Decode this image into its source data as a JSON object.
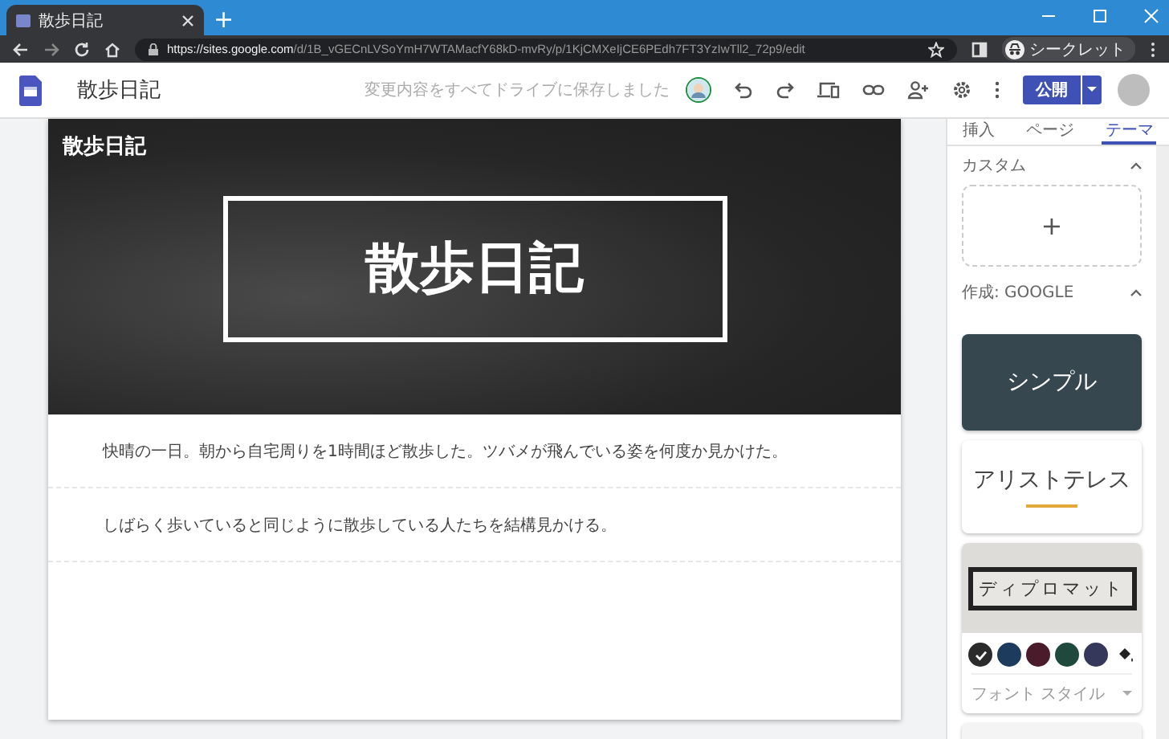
{
  "browser": {
    "tab_title": "散歩日記",
    "new_tab": "+",
    "url_host": "https://sites.google.com",
    "url_path": "/d/1B_vGECnLVSoYmH7WTAMacfY68kD-mvRy/p/1KjCMXeIjCE6PEdh7FT3YzIwTll2_72p9/edit",
    "profile": "シークレット"
  },
  "toolbar": {
    "site_title": "散歩日記",
    "save_status": "変更内容をすべてドライブに保存しました",
    "publish": "公開"
  },
  "page": {
    "header_label": "散歩日記",
    "banner_title": "散歩日記",
    "paragraphs": [
      "快晴の一日。朝から自宅周りを1時間ほど散歩した。ツバメが飛んでいる姿を何度か見かけた。",
      "しばらく歩いていると同じように散歩している人たちを結構見かける。"
    ]
  },
  "sidebar": {
    "tabs": [
      {
        "label": "挿入",
        "selected": false
      },
      {
        "label": "ページ",
        "selected": false
      },
      {
        "label": "テーマ",
        "selected": true
      }
    ],
    "custom_label": "カスタム",
    "add": "+",
    "google_label": "作成: GOOGLE",
    "themes": [
      {
        "kind": "simple",
        "name": "シンプル",
        "expanded": false
      },
      {
        "kind": "aristotle",
        "name": "アリストテレス",
        "expanded": false
      },
      {
        "kind": "diplomat",
        "name": "ディプロマット",
        "expanded": true
      }
    ],
    "colors": [
      {
        "color": "#2b2b2b",
        "selected": true
      },
      {
        "color": "#1d3b5c",
        "selected": false
      },
      {
        "color": "#4a1b2b",
        "selected": false
      },
      {
        "color": "#20493d",
        "selected": false
      },
      {
        "color": "#35385a",
        "selected": false
      }
    ],
    "font_style": "フォント スタイル"
  }
}
